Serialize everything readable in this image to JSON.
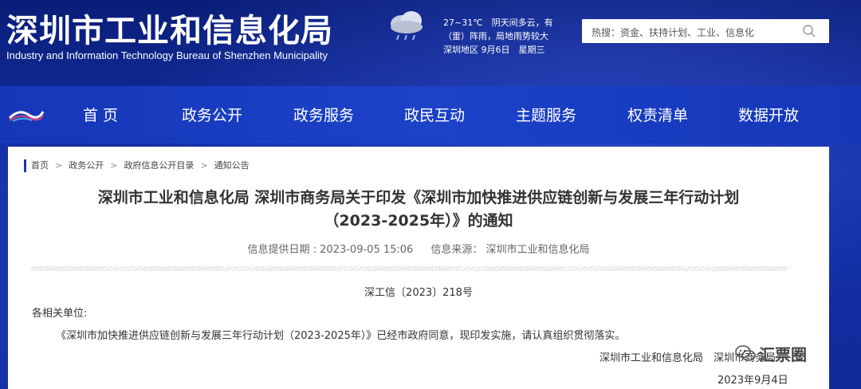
{
  "header": {
    "title_cn": "深圳市工业和信息化局",
    "title_en": "Industry and Information Technology Bureau of Shenzhen Municipality",
    "weather": {
      "line1": "27~31℃　阴天间多云，有",
      "line2": "（雷）阵雨，局地雨势较大",
      "line3": "深圳地区  9月6日　星期三",
      "icon": "rain-cloud-icon"
    },
    "search": {
      "hint": "热搜：资金、扶持计划、工业、信息化",
      "icon": "search-icon"
    }
  },
  "nav": {
    "items": [
      {
        "label": "首 页"
      },
      {
        "label": "政务公开"
      },
      {
        "label": "政务服务"
      },
      {
        "label": "政民互动"
      },
      {
        "label": "主题服务"
      },
      {
        "label": "权责清单"
      },
      {
        "label": "数据开放"
      }
    ]
  },
  "breadcrumb": [
    "首页",
    "政务公开",
    "政府信息公开目录",
    "通知公告"
  ],
  "breadcrumb_sep": ">",
  "article": {
    "title_line1": "深圳市工业和信息化局 深圳市商务局关于印发《深圳市加快推进供应链创新与发展三年行动计划",
    "title_line2": "（2023-2025年）》的通知",
    "date_label": "信息提供日期 : 2023-09-05 15:06",
    "source_label": "信息来源：",
    "source_value": "深圳市工业和信息化局",
    "doc_number": "深工信〔2023〕218号",
    "recipients": "各相关单位:",
    "body": "《深圳市加快推进供应链创新与发展三年行动计划（2023-2025年）》已经市政府同意，现印发实施，请认真组织贯彻落实。",
    "signature": "深圳市工业和信息化局　深圳市商务局",
    "sign_date": "2023年9月4日"
  },
  "watermark": {
    "text": "汇票圈"
  },
  "colors": {
    "header_bg": "#0b1f7a",
    "nav_bg": "#1c42c8",
    "accent": "#1a3aa6"
  }
}
